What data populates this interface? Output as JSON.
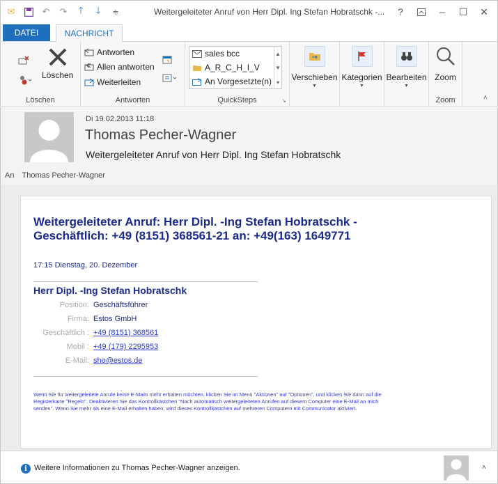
{
  "window": {
    "title": "Weitergeleiteter Anruf von Herr Dipl. Ing Stefan Hobratschk -...",
    "help": "?"
  },
  "tabs": [
    {
      "label": "DATEI"
    },
    {
      "label": "NACHRICHT"
    }
  ],
  "ribbon": {
    "groups": {
      "delete": {
        "label": "Löschen",
        "delete_button": "Löschen"
      },
      "respond": {
        "label": "Antworten",
        "reply": "Antworten",
        "reply_all": "Allen antworten",
        "forward": "Weiterleiten"
      },
      "quicksteps": {
        "label": "QuickSteps",
        "items": [
          "sales bcc",
          "A_R_C_H_I_V",
          "An Vorgesetzte(n)"
        ]
      },
      "move": {
        "label": "Verschieben"
      },
      "tags": {
        "label": "Kategorien"
      },
      "edit": {
        "label": "Bearbeiten"
      },
      "zoom": {
        "label": "Zoom",
        "group_label": "Zoom"
      }
    }
  },
  "header": {
    "date": "Di 19.02.2013 11:18",
    "sender": "Thomas Pecher-Wagner",
    "subject": "Weitergeleiteter Anruf von Herr Dipl. Ing Stefan Hobratschk",
    "to_label": "An",
    "to_value": "Thomas Pecher-Wagner"
  },
  "message": {
    "title": "Weitergeleiteter Anruf: Herr Dipl. -Ing Stefan Hobratschk - Geschäftlich: +49 (8151) 368561-21 an: +49(163) 1649771",
    "time": "17:15 Dienstag, 20. Dezember",
    "contact_name": "Herr Dipl. -Ing Stefan Hobratschk",
    "fields": [
      {
        "key": "Position:",
        "value": "Geschäftsführer",
        "link": false
      },
      {
        "key": "Firma:",
        "value": "Estos GmbH",
        "link": false
      },
      {
        "key": "Geschäftlich :",
        "value": "+49 (8151) 368561",
        "link": true
      },
      {
        "key": "Mobil :",
        "value": "+49 (179) 2295953",
        "link": true
      },
      {
        "key": "E-Mail:",
        "value": "sho@estos.de",
        "link": true
      }
    ],
    "note": "Wenn Sie für weitergeleitete Anrufe keine E-Mails mehr erhalten möchten, klicken Sie im Menü \"Aktionen\" auf \"Optionen\", und klicken Sie dann auf die Registerkarte \"Regeln\". Deaktivieren Sie das Kontrollkästchen \"Nach automatisch weitergeleiteten Anrufen auf diesem Computer eine E-Mail an mich senden\". Wenn Sie mehr als eine E-Mail erhalten haben, wird dieses Kontrollkästchen auf mehreren Computern mit Communicator aktiviert."
  },
  "footer": {
    "info_text": "Weitere Informationen zu Thomas Pecher-Wagner anzeigen."
  },
  "colors": {
    "accent": "#1e6fbd",
    "message_blue": "#1a2a8c",
    "link_blue": "#2a3ad8"
  }
}
